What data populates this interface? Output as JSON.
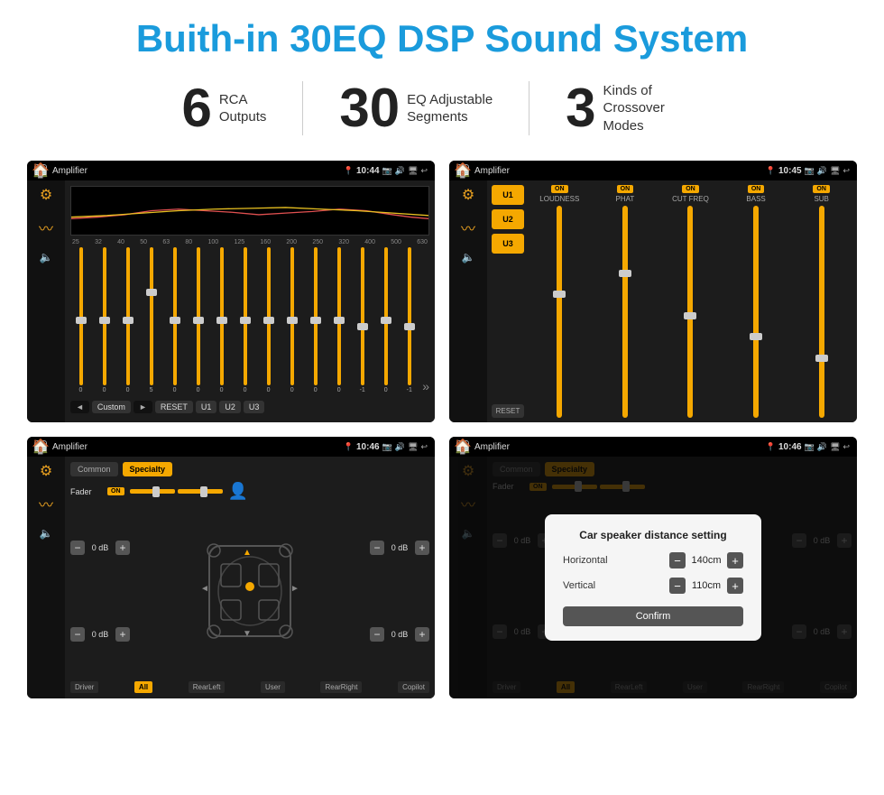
{
  "title": "Buith-in 30EQ DSP Sound System",
  "stats": [
    {
      "number": "6",
      "text": "RCA\nOutputs"
    },
    {
      "number": "30",
      "text": "EQ Adjustable\nSegments"
    },
    {
      "number": "3",
      "text": "Kinds of\nCrossover Modes"
    }
  ],
  "screens": [
    {
      "id": "eq-screen",
      "status_bar": {
        "app": "Amplifier",
        "time": "10:44"
      },
      "type": "equalizer",
      "freq_labels": [
        "25",
        "32",
        "40",
        "50",
        "63",
        "80",
        "100",
        "125",
        "160",
        "200",
        "250",
        "320",
        "400",
        "500",
        "630"
      ],
      "eq_values": [
        "0",
        "0",
        "0",
        "5",
        "0",
        "0",
        "0",
        "0",
        "0",
        "0",
        "0",
        "0",
        "-1",
        "0",
        "-1"
      ],
      "bottom_buttons": [
        "◄",
        "Custom",
        "►",
        "RESET",
        "U1",
        "U2",
        "U3"
      ]
    },
    {
      "id": "amp2-screen",
      "status_bar": {
        "app": "Amplifier",
        "time": "10:45"
      },
      "type": "amp-channels",
      "u_buttons": [
        "U1",
        "U2",
        "U3"
      ],
      "channels": [
        "LOUDNESS",
        "PHAT",
        "CUT FREQ",
        "BASS",
        "SUB"
      ],
      "reset_label": "RESET"
    },
    {
      "id": "fader-screen",
      "status_bar": {
        "app": "Amplifier",
        "time": "10:46"
      },
      "type": "fader",
      "tabs": [
        "Common",
        "Specialty"
      ],
      "fader_label": "Fader",
      "on_label": "ON",
      "volumes": [
        "0 dB",
        "0 dB",
        "0 dB",
        "0 dB"
      ],
      "bottom_labels": [
        "Driver",
        "All",
        "RearLeft",
        "User",
        "RearRight",
        "Copilot"
      ]
    },
    {
      "id": "dialog-screen",
      "status_bar": {
        "app": "Amplifier",
        "time": "10:46"
      },
      "type": "fader-dialog",
      "dialog": {
        "title": "Car speaker distance setting",
        "horizontal_label": "Horizontal",
        "horizontal_value": "140cm",
        "vertical_label": "Vertical",
        "vertical_value": "110cm",
        "confirm_label": "Confirm"
      },
      "fader_label": "Fader",
      "on_label": "ON"
    }
  ]
}
